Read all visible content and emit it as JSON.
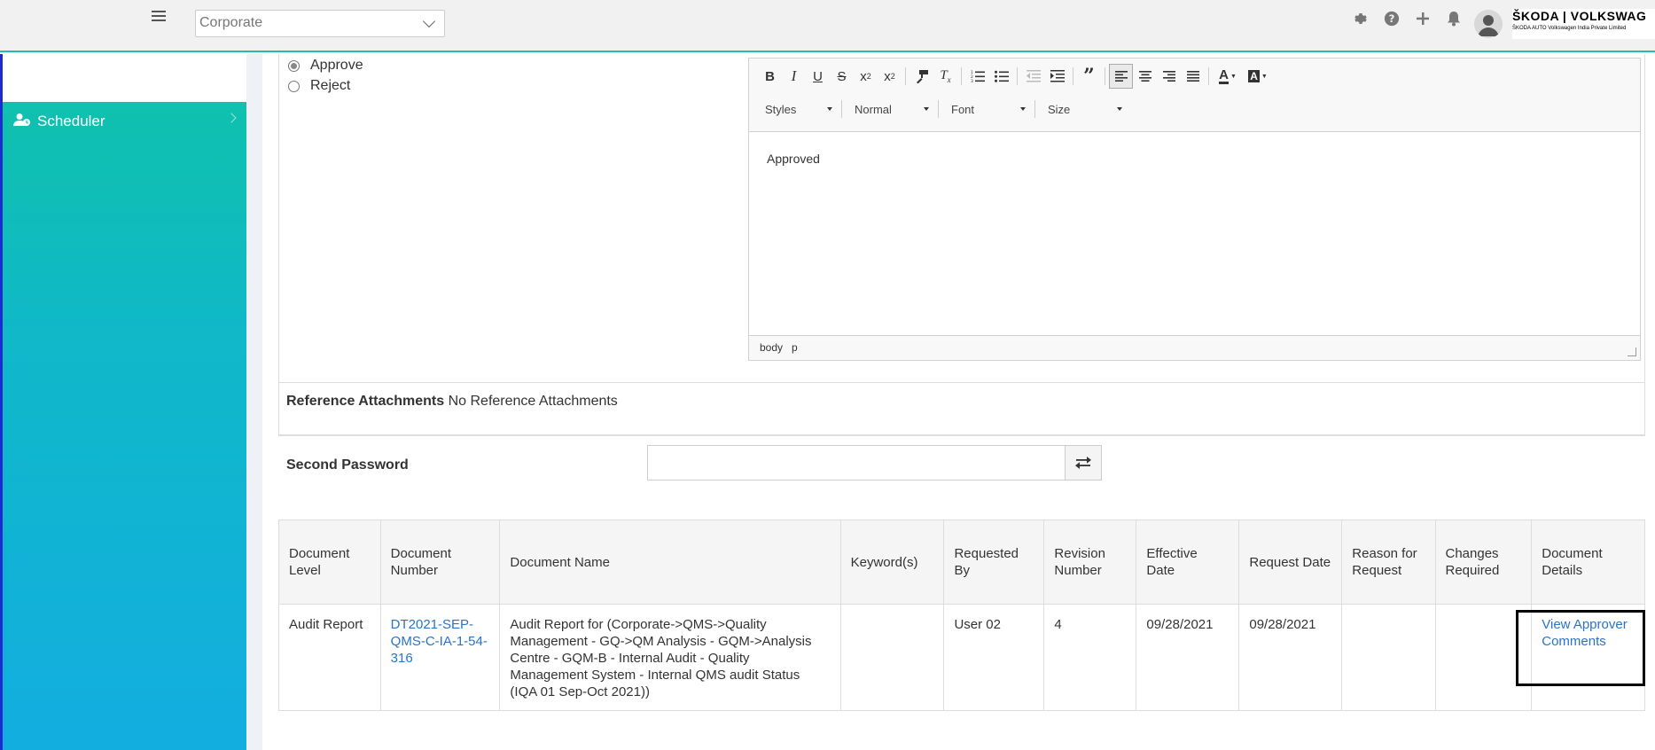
{
  "header": {
    "org_select_value": "Corporate",
    "brand_line1": "ŠKODA | VOLKSWAG",
    "brand_line2": "ŠKODA AUTO Volkswagen India Private Limited",
    "icons": [
      "gear-icon",
      "help-icon",
      "plus-icon",
      "bell-icon",
      "avatar"
    ]
  },
  "sidebar": {
    "items": [
      {
        "label": "Scheduler",
        "icon": "user-clock-icon"
      }
    ]
  },
  "review": {
    "approve_label": "Approve",
    "reject_label": "Reject",
    "selected": "Approve"
  },
  "editor": {
    "toolbar": {
      "styles": "Styles",
      "format": "Normal",
      "font": "Font",
      "size": "Size"
    },
    "content": "Approved",
    "path": [
      "body",
      "p"
    ]
  },
  "attachments": {
    "label": "Reference Attachments",
    "value": "No Reference Attachments"
  },
  "second_password": {
    "label": "Second Password",
    "value": ""
  },
  "table": {
    "headers": [
      "Document Level",
      "Document Number",
      "Document Name",
      "Keyword(s)",
      "Requested By",
      "Revision Number",
      "Effective Date",
      "Request Date",
      "Reason for Request",
      "Changes Required",
      "Document Details"
    ],
    "rows": [
      {
        "level": "Audit Report",
        "number": "DT2021-SEP-QMS-C-IA-1-54-316",
        "name": "Audit Report for (Corporate->QMS->Quality Management - GQ->QM Analysis - GQM->Analysis Centre - GQM-B - Internal Audit - Quality Management System - Internal QMS audit Status (IQA 01 Sep-Oct 2021))",
        "keywords": "",
        "requested_by": "User 02",
        "revision": "4",
        "effective_date": "09/28/2021",
        "request_date": "09/28/2021",
        "reason": "",
        "changes": "",
        "details_link": "View Approver Comments"
      }
    ]
  },
  "colors": {
    "accent": "#2ab7b0",
    "sidebar_top": "#0fc3a8",
    "sidebar_bottom": "#12aee0",
    "link": "#2a73c9"
  }
}
